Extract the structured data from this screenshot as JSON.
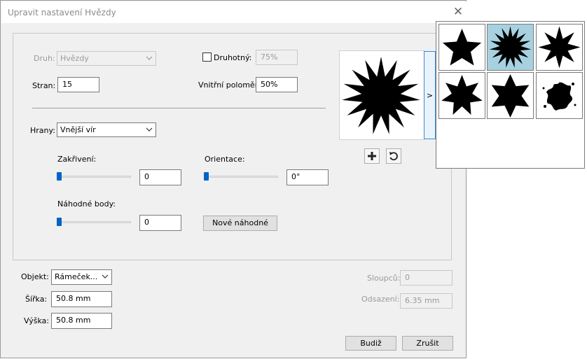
{
  "dialog": {
    "title": "Upravit nastavení Hvězdy",
    "close_glyph": "✕"
  },
  "shape": {
    "type_label": "Druh:",
    "type_value": "Hvězdy",
    "sides_label": "Stran:",
    "sides_value": "15",
    "secondary_label": "Druhotný:",
    "secondary_checked": false,
    "secondary_value": "75%",
    "inner_radius_label": "Vnitřní poloměr:",
    "inner_radius_value": "50%"
  },
  "edges": {
    "label": "Hrany:",
    "value": "Vnější vír",
    "curvature_label": "Zakřivení:",
    "curvature_value": "0",
    "curvature_level": 0,
    "orientation_label": "Orientace:",
    "orientation_value": "0°",
    "orientation_level": 0,
    "random_label": "Náhodné body:",
    "random_value": "0",
    "random_level": 0,
    "new_random_label": "Nové náhodné"
  },
  "preview": {
    "expand_label": ">",
    "add_icon": "plus-icon",
    "reset_icon": "rotate-icon"
  },
  "palette": {
    "presets": [
      "star-5",
      "star-15-selected",
      "star-8",
      "star-7",
      "star-6",
      "swirl-blob"
    ],
    "selected_index": 1
  },
  "object": {
    "label": "Objekt:",
    "value": "Rámeček..."
  },
  "size": {
    "width_label": "Šířka:",
    "width_value": "50.8 mm",
    "height_label": "Výška:",
    "height_value": "50.8 mm"
  },
  "columns": {
    "label": "Sloupců:",
    "value": "0",
    "gap_label": "Odsazení:",
    "gap_value": "6.35 mm"
  },
  "footer": {
    "ok_label": "Budiž",
    "cancel_label": "Zrušit"
  },
  "colors": {
    "accent": "#0063c5",
    "selected_cell": "#a7d1e1"
  }
}
